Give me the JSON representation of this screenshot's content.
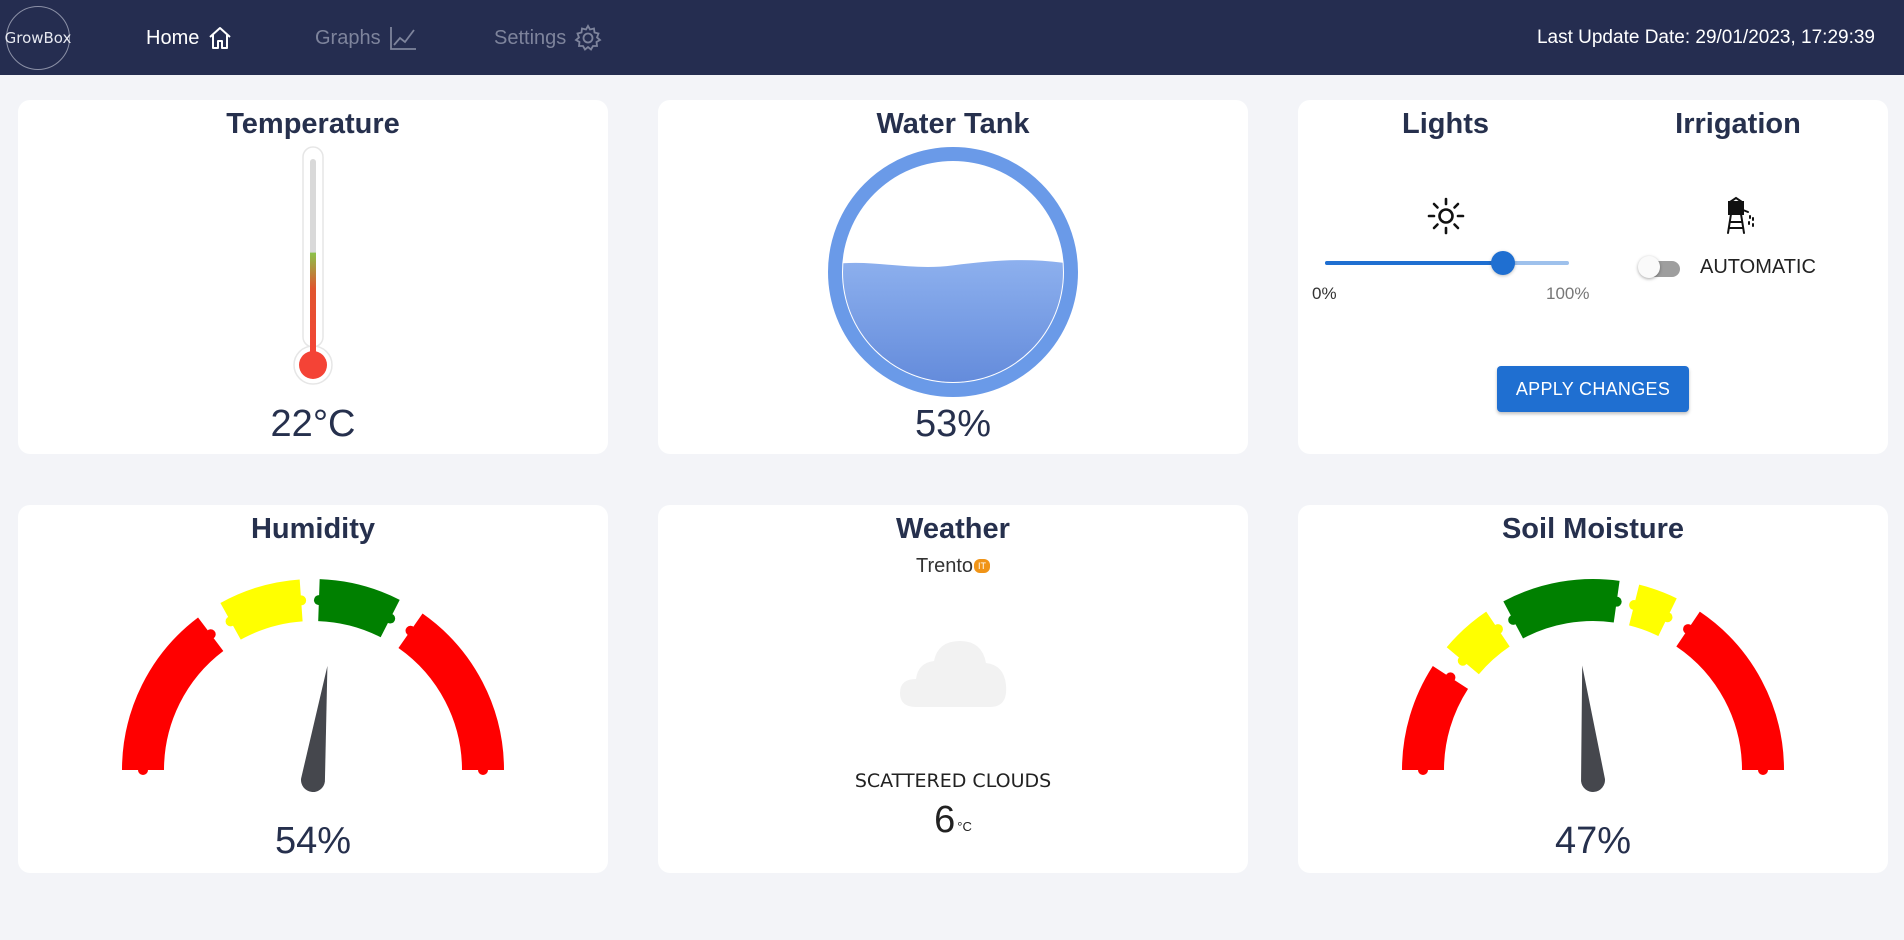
{
  "nav": {
    "logo": "GrowBox",
    "items": [
      {
        "label": "Home",
        "icon": "home-icon",
        "active": true
      },
      {
        "label": "Graphs",
        "icon": "graph-icon",
        "active": false
      },
      {
        "label": "Settings",
        "icon": "gear-icon",
        "active": false
      }
    ],
    "last_update": "Last Update Date: 29/01/2023, 17:29:39"
  },
  "temperature": {
    "title": "Temperature",
    "value": "22°C",
    "level": 0.48,
    "colors": {
      "mercury": "#f44336",
      "bulb": "#f44336",
      "top": "#8bc34a"
    }
  },
  "water_tank": {
    "title": "Water Tank",
    "value": "53%",
    "level_percent": 53,
    "colors": {
      "ring": "#6a9ae8",
      "water_top": "#8db0ee",
      "water_bottom": "#5f87d9"
    }
  },
  "controls": {
    "lights": {
      "title": "Lights",
      "icon": "sun-icon",
      "slider_value_percent": 73,
      "min_label": "0%",
      "max_label": "100%"
    },
    "irrigation": {
      "title": "Irrigation",
      "icon": "water-tower-icon",
      "toggle_on": false,
      "toggle_label": "AUTOMATIC"
    },
    "apply_label": "APPLY CHANGES",
    "accent": "#1f6fd1"
  },
  "humidity": {
    "title": "Humidity",
    "value": "54%",
    "needle_percent": 54,
    "bands": [
      "#ff0000",
      "#ffff00",
      "#008000",
      "#ff0000"
    ]
  },
  "weather": {
    "title": "Weather",
    "city": "Trento",
    "country": "IT",
    "icon": "cloud-icon",
    "description": "SCATTERED CLOUDS",
    "temperature": "6",
    "unit": "°C"
  },
  "soil_moisture": {
    "title": "Soil Moisture",
    "value": "47%",
    "needle_percent": 47,
    "bands": [
      "#ff0000",
      "#ffff00",
      "#008000",
      "#ffff00",
      "#ff0000"
    ]
  }
}
